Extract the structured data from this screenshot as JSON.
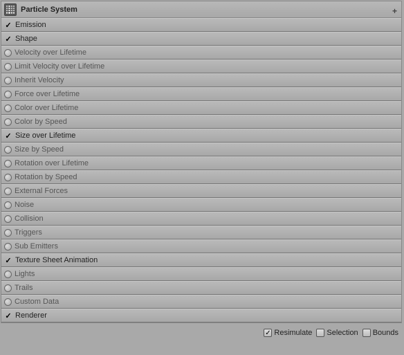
{
  "header": {
    "title": "Particle System",
    "plus": "+"
  },
  "modules": [
    {
      "label": "Emission",
      "checked": true
    },
    {
      "label": "Shape",
      "checked": true
    },
    {
      "label": "Velocity over Lifetime",
      "checked": false
    },
    {
      "label": "Limit Velocity over Lifetime",
      "checked": false
    },
    {
      "label": "Inherit Velocity",
      "checked": false
    },
    {
      "label": "Force over Lifetime",
      "checked": false
    },
    {
      "label": "Color over Lifetime",
      "checked": false
    },
    {
      "label": "Color by Speed",
      "checked": false
    },
    {
      "label": "Size over Lifetime",
      "checked": true
    },
    {
      "label": "Size by Speed",
      "checked": false
    },
    {
      "label": "Rotation over Lifetime",
      "checked": false
    },
    {
      "label": "Rotation by Speed",
      "checked": false
    },
    {
      "label": "External Forces",
      "checked": false
    },
    {
      "label": "Noise",
      "checked": false
    },
    {
      "label": "Collision",
      "checked": false
    },
    {
      "label": "Triggers",
      "checked": false
    },
    {
      "label": "Sub Emitters",
      "checked": false
    },
    {
      "label": "Texture Sheet Animation",
      "checked": true
    },
    {
      "label": "Lights",
      "checked": false
    },
    {
      "label": "Trails",
      "checked": false
    },
    {
      "label": "Custom Data",
      "checked": false
    },
    {
      "label": "Renderer",
      "checked": true
    }
  ],
  "footer": {
    "resimulate": {
      "label": "Resimulate",
      "checked": true
    },
    "selection": {
      "label": "Selection",
      "checked": false
    },
    "bounds": {
      "label": "Bounds",
      "checked": false
    }
  }
}
